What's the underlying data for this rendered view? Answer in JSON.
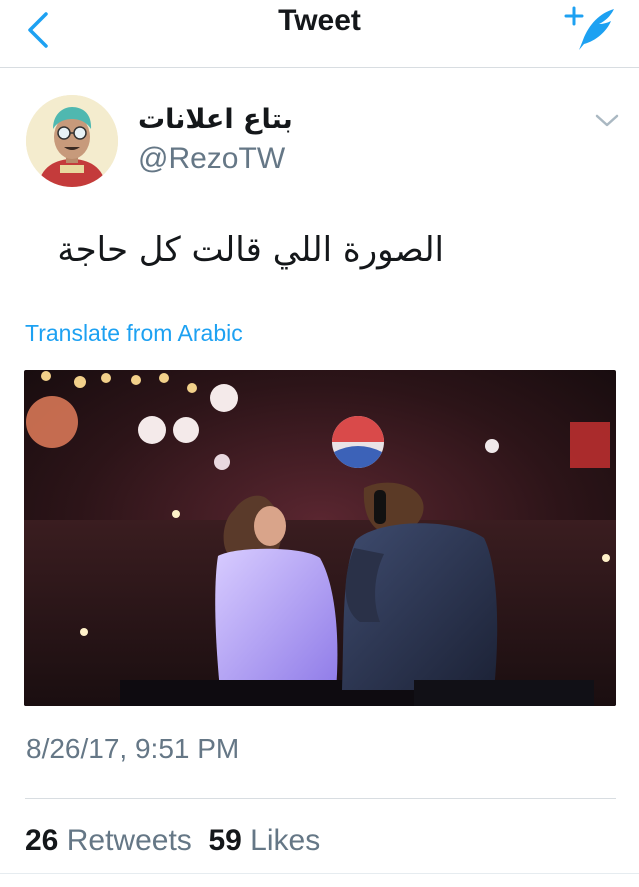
{
  "nav": {
    "title": "Tweet",
    "back_icon": "chevron-left-icon",
    "compose_icon": "compose-feather-icon",
    "accent_color": "#1da1f2"
  },
  "author": {
    "display_name": "بتاع اعلانات",
    "handle": "@RezoTW"
  },
  "tweet": {
    "text": "الصورة اللي قالت كل حاجة",
    "translate_link": "Translate from Arabic",
    "timestamp": "8/26/17, 9:51 PM"
  },
  "stats": {
    "retweets_count": "26",
    "retweets_label": "Retweets",
    "likes_count": "59",
    "likes_label": "Likes"
  },
  "colors": {
    "text_primary": "#14171a",
    "text_secondary": "#657786",
    "divider": "#d8dde1"
  }
}
